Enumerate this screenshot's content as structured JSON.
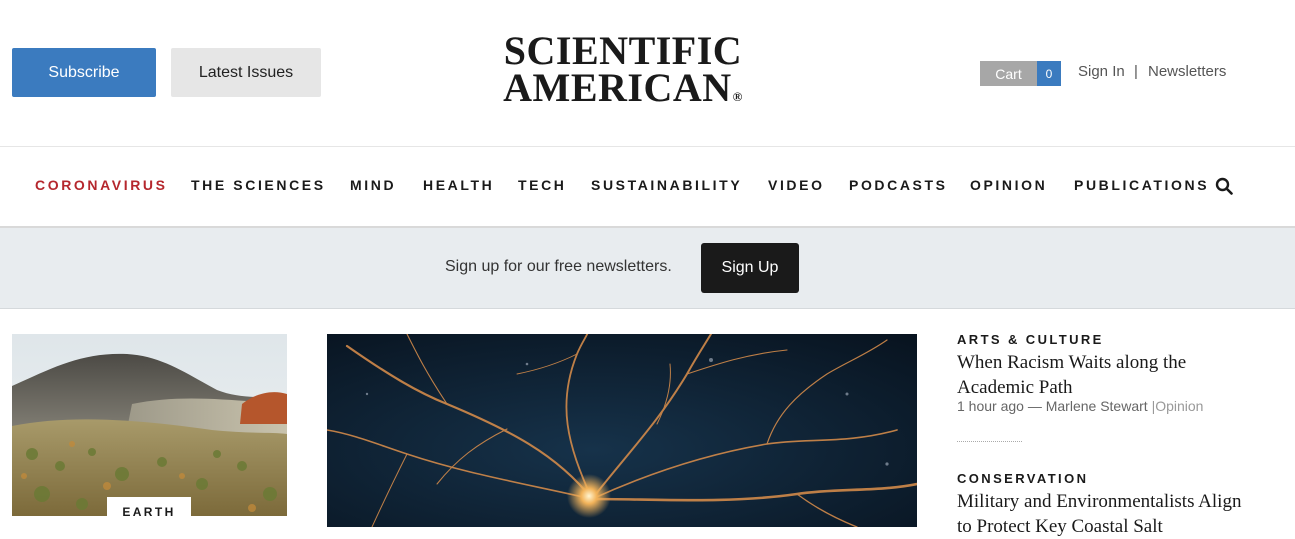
{
  "header": {
    "subscribe_label": "Subscribe",
    "latest_issues_label": "Latest Issues",
    "logo_line1": "SCIENTIFIC",
    "logo_line2": "AMERICAN",
    "logo_mark": "®",
    "cart_label": "Cart",
    "cart_count": "0",
    "sign_in_label": "Sign In",
    "separator": "|",
    "newsletters_label": "Newsletters"
  },
  "nav": {
    "items": [
      {
        "label": "CORONAVIRUS"
      },
      {
        "label": "THE SCIENCES"
      },
      {
        "label": "MIND"
      },
      {
        "label": "HEALTH"
      },
      {
        "label": "TECH"
      },
      {
        "label": "SUSTAINABILITY"
      },
      {
        "label": "VIDEO"
      },
      {
        "label": "PODCASTS"
      },
      {
        "label": "OPINION"
      },
      {
        "label": "PUBLICATIONS"
      }
    ],
    "search_icon": "search-icon"
  },
  "newsletter_bar": {
    "text": "Sign up for our free newsletters.",
    "button_label": "Sign Up"
  },
  "content": {
    "left_card": {
      "tag": "EARTH"
    },
    "sidebar": [
      {
        "kicker": "ARTS & CULTURE",
        "headline": "When Racism Waits along the Academic Path",
        "time": "1 hour ago",
        "dash": "—",
        "author": "Marlene Stewart",
        "sep": "|",
        "section": "Opinion"
      },
      {
        "kicker": "CONSERVATION",
        "headline": "Military and Environmentalists Align to Protect Key Coastal Salt"
      }
    ]
  },
  "colors": {
    "brand_blue": "#3b7bbf",
    "coronavirus_red": "#b5272d",
    "newsletter_bg": "#e8ecef",
    "signup_black": "#1a1a1a"
  }
}
